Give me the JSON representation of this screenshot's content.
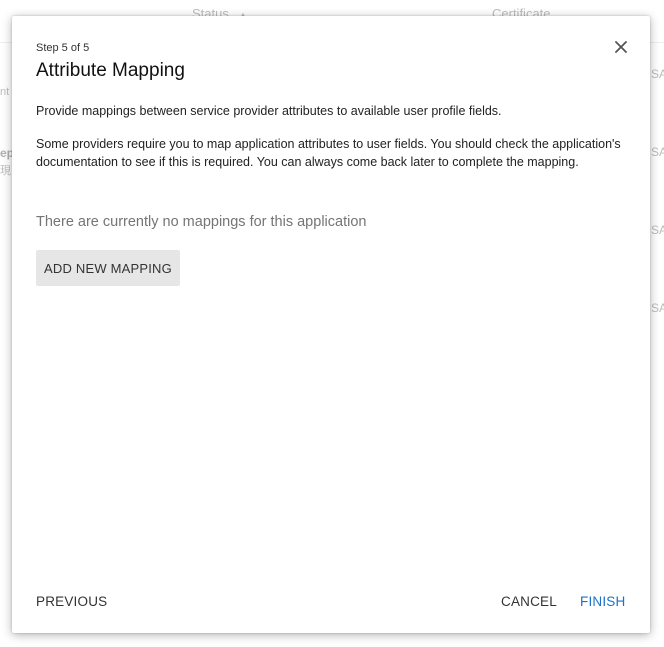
{
  "background": {
    "table_headers": {
      "status": "Status",
      "certificate": "Certificate"
    },
    "left_fragments": [
      "nt",
      "ep",
      "現"
    ],
    "right_fragments": [
      "SA",
      "SA",
      "SA",
      "SA"
    ]
  },
  "dialog": {
    "step_label": "Step 5 of 5",
    "title": "Attribute Mapping",
    "description_1": "Provide mappings between service provider attributes to available user profile fields.",
    "description_2": "Some providers require you to map application attributes to user fields. You should check the application's documentation to see if this is required. You can always come back later to complete the mapping.",
    "empty_message": "There are currently no mappings for this application",
    "add_mapping_label": "ADD NEW MAPPING",
    "footer": {
      "previous_label": "PREVIOUS",
      "cancel_label": "CANCEL",
      "finish_label": "FINISH"
    },
    "icons": {
      "close": "close-icon"
    },
    "colors": {
      "accent": "#1a73c8",
      "button_bg": "#e6e6e6"
    }
  }
}
